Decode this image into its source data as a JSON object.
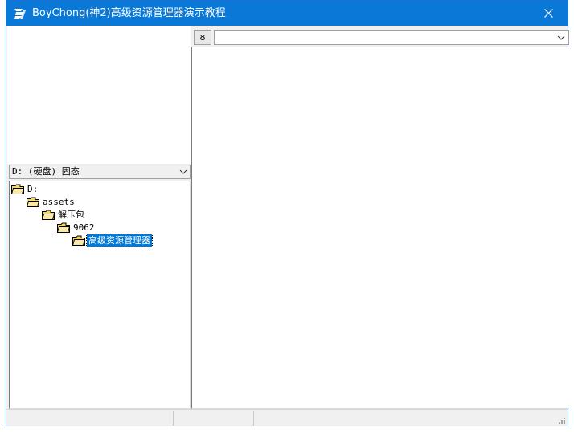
{
  "window": {
    "title": "BoyChong(神2)高级资源管理器演示教程"
  },
  "titlebar": {
    "close_icon": "close-icon",
    "app_icon": "app-icon"
  },
  "drive_select": {
    "value": "D: (硬盘) 固态"
  },
  "tree": {
    "nodes": [
      {
        "label": "D:"
      },
      {
        "label": "assets"
      },
      {
        "label": "解压包"
      },
      {
        "label": "9062"
      },
      {
        "label": "高级资源管理器",
        "selected": true
      }
    ]
  },
  "toolbar": {
    "sort_label": "ȣ"
  },
  "path_combo": {
    "value": ""
  },
  "colors": {
    "titlebar": "#0a78d7",
    "selection": "#0078d7",
    "folder": "#f5d76e"
  }
}
